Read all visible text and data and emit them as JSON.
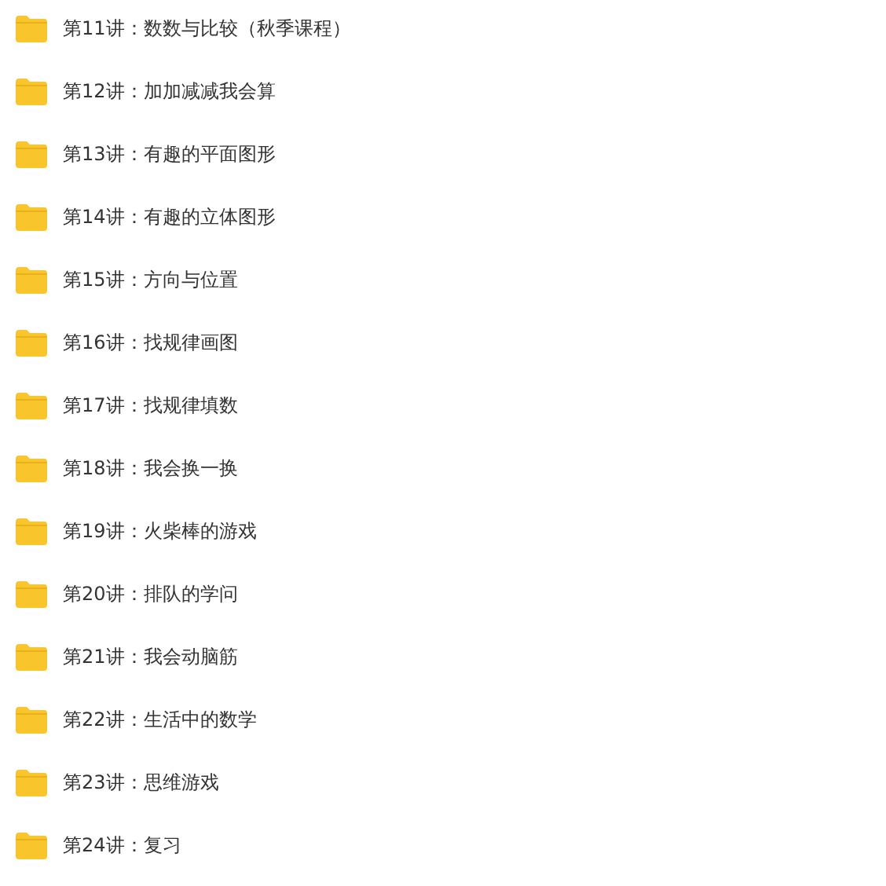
{
  "folders": [
    {
      "name": "第11讲：数数与比较（秋季课程）"
    },
    {
      "name": "第12讲：加加减减我会算"
    },
    {
      "name": "第13讲：有趣的平面图形"
    },
    {
      "name": "第14讲：有趣的立体图形"
    },
    {
      "name": "第15讲：方向与位置"
    },
    {
      "name": "第16讲：找规律画图"
    },
    {
      "name": "第17讲：找规律填数"
    },
    {
      "name": "第18讲：我会换一换"
    },
    {
      "name": "第19讲：火柴棒的游戏"
    },
    {
      "name": "第20讲：排队的学问"
    },
    {
      "name": "第21讲：我会动脑筋"
    },
    {
      "name": "第22讲：生活中的数学"
    },
    {
      "name": "第23讲：思维游戏"
    },
    {
      "name": "第24讲：复习"
    }
  ]
}
